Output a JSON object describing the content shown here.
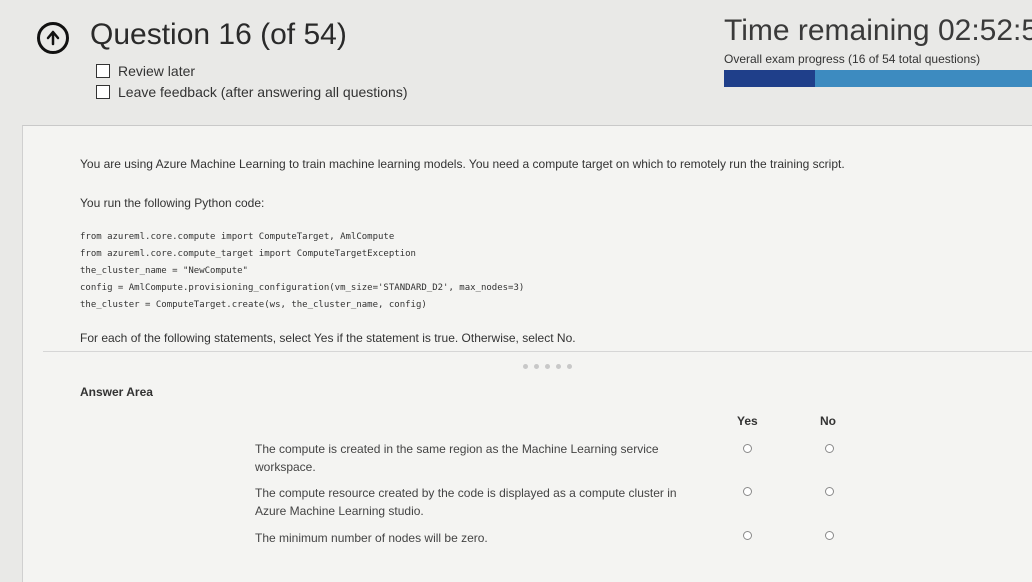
{
  "header": {
    "question_title": "Question 16 (of 54)",
    "review_later_label": "Review later",
    "leave_feedback_label": "Leave feedback (after answering all questions)",
    "time_remaining": "Time remaining 02:52:5",
    "progress_label": "Overall exam progress (16 of 54 total questions)",
    "progress_fraction": 0.296,
    "colors": {
      "progress_fill": "#1f3f8a",
      "progress_track": "#3d8bc0"
    }
  },
  "question": {
    "intro": "You are using Azure Machine Learning to train machine learning models. You need a compute target on which to remotely run the training script.",
    "code_intro": "You run the following Python code:",
    "code_lines": [
      "from azureml.core.compute import ComputeTarget, AmlCompute",
      "from azureml.core.compute_target import ComputeTargetException",
      "the_cluster_name = \"NewCompute\"",
      "config = AmlCompute.provisioning_configuration(vm_size='STANDARD_D2', max_nodes=3)",
      "the_cluster = ComputeTarget.create(ws, the_cluster_name, config)"
    ],
    "instruction": "For each of the following statements, select Yes if the statement is true. Otherwise, select No."
  },
  "answer_area": {
    "title": "Answer Area",
    "yes_label": "Yes",
    "no_label": "No",
    "statements": [
      "The compute is created in the same region as the Machine Learning service workspace.",
      "The compute resource created by the code is displayed as a compute cluster in Azure Machine Learning studio.",
      "The minimum number of nodes will be zero."
    ]
  }
}
